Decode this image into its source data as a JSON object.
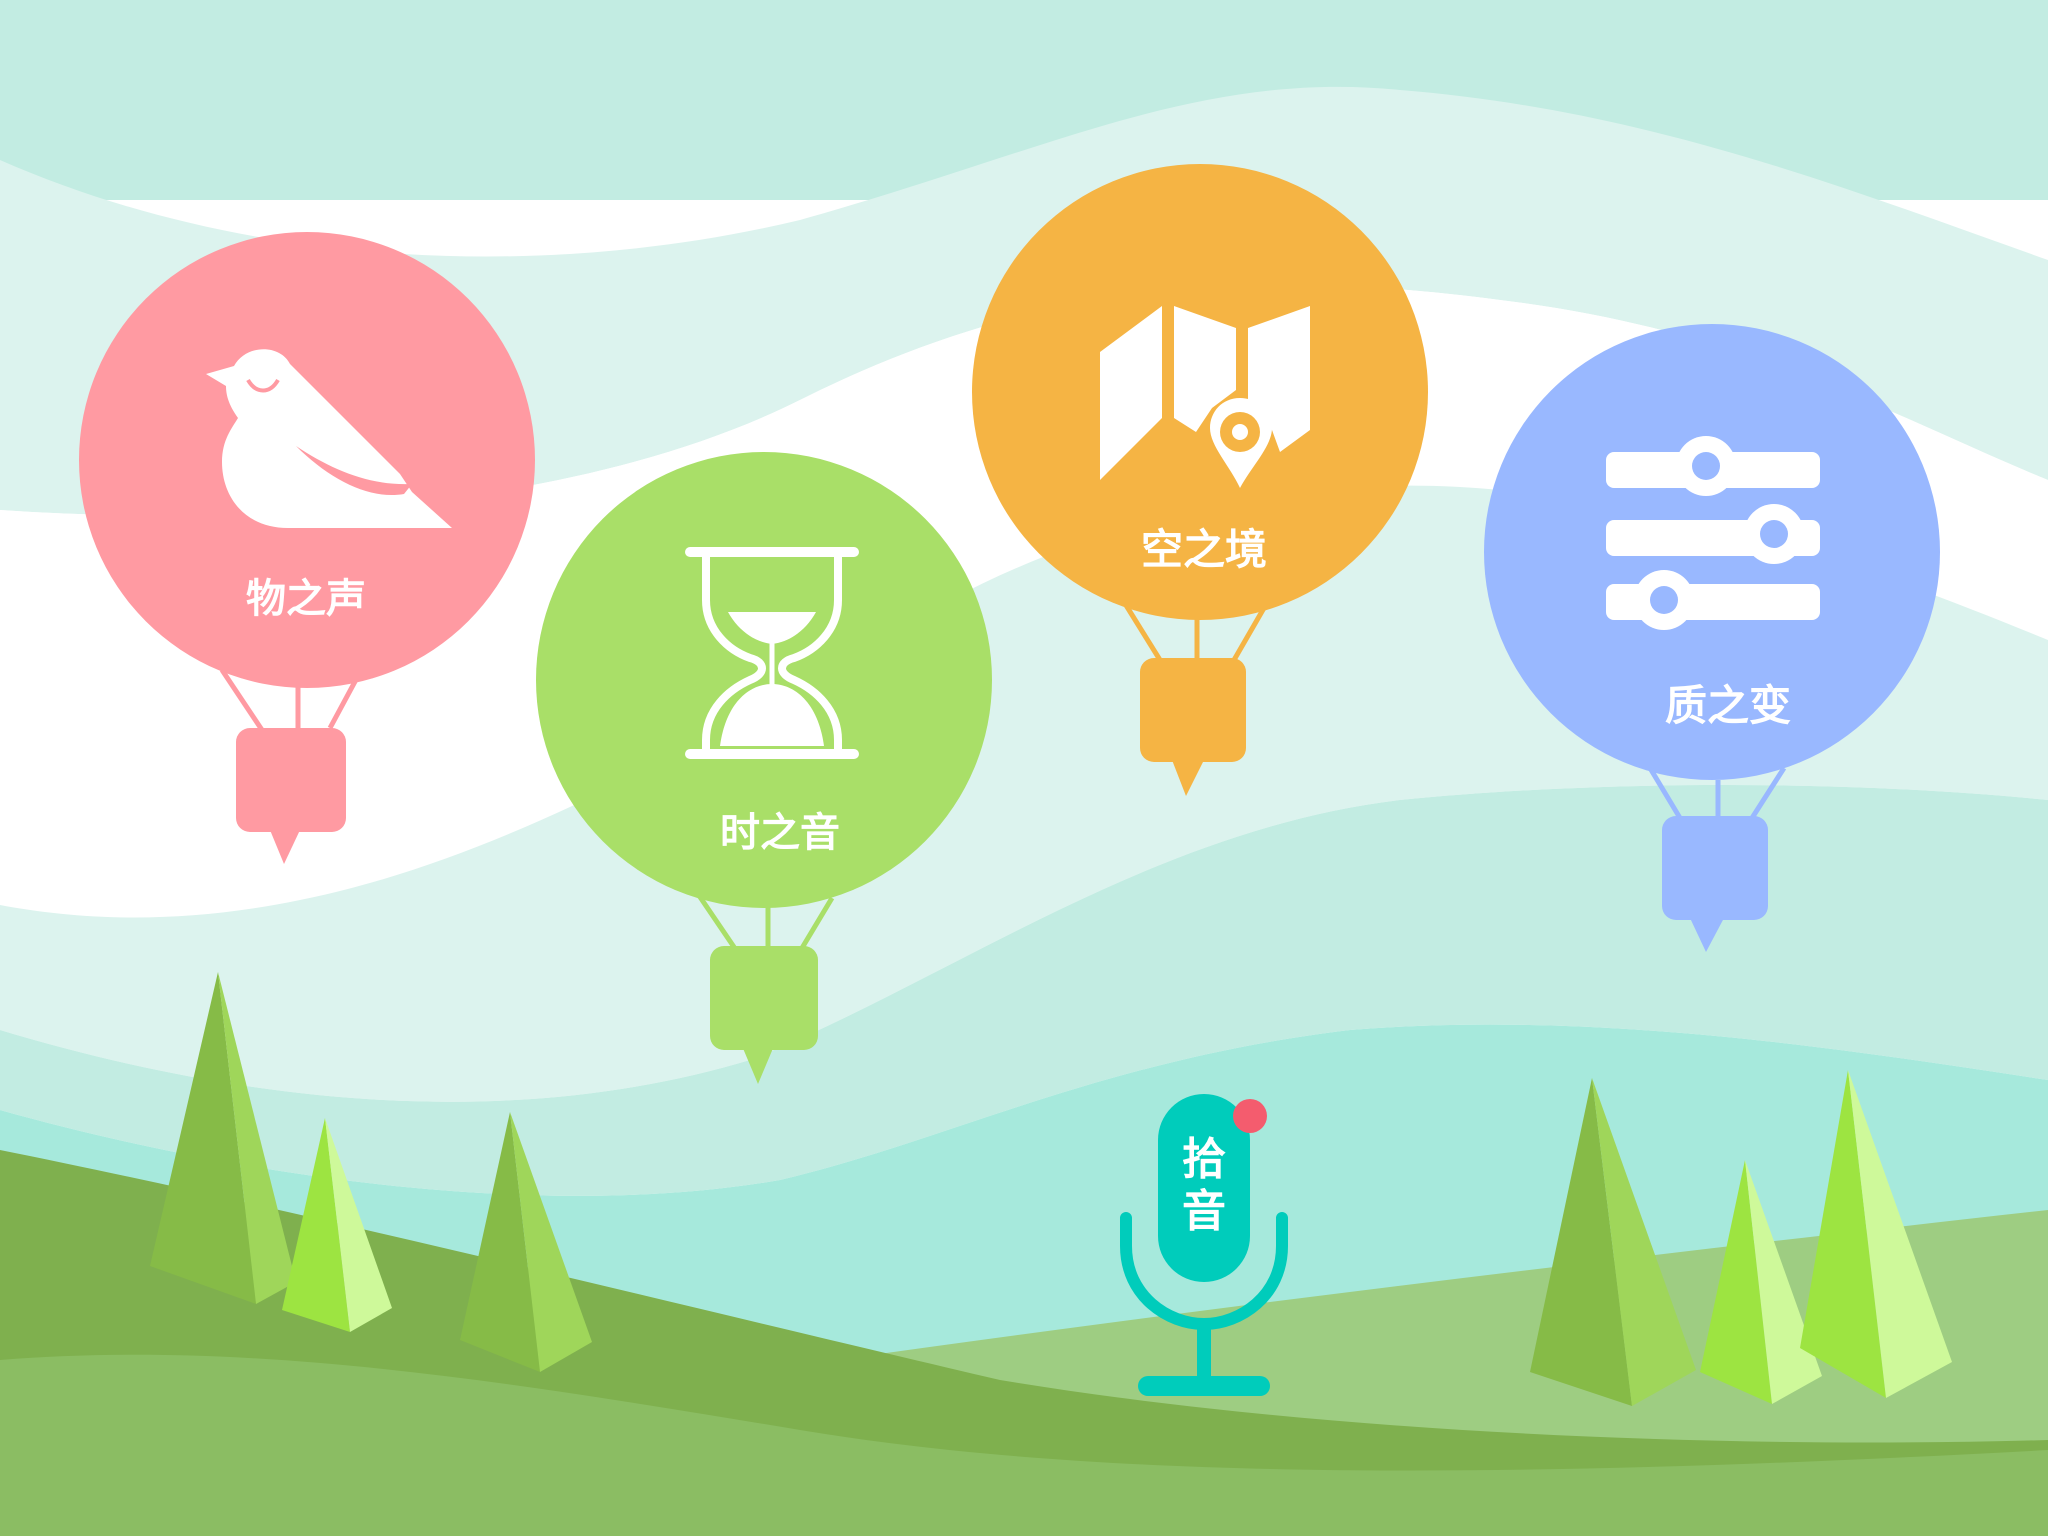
{
  "balloons": [
    {
      "id": "wu",
      "label": "物之声",
      "icon": "bird-icon",
      "color": "#ff9aa2"
    },
    {
      "id": "shi",
      "label": "时之音",
      "icon": "hourglass-icon",
      "color": "#a9df68"
    },
    {
      "id": "kong",
      "label": "空之境",
      "icon": "map-pin-icon",
      "color": "#f5b444"
    },
    {
      "id": "zhi",
      "label": "质之变",
      "icon": "sliders-icon",
      "color": "#99b8ff"
    }
  ],
  "mic": {
    "label_line1": "拾",
    "label_line2": "音",
    "icon": "microphone-icon",
    "color": "#00ccbb",
    "notification_color": "#f45c6e"
  },
  "colors": {
    "sky_light": "#dcf3ee",
    "sky_mid": "#c2ece2",
    "sky_deep": "#a6e9dc",
    "grass_dark": "#7fb04e",
    "grass_mid": "#8bbd63",
    "grass_light": "#9ecd82"
  }
}
